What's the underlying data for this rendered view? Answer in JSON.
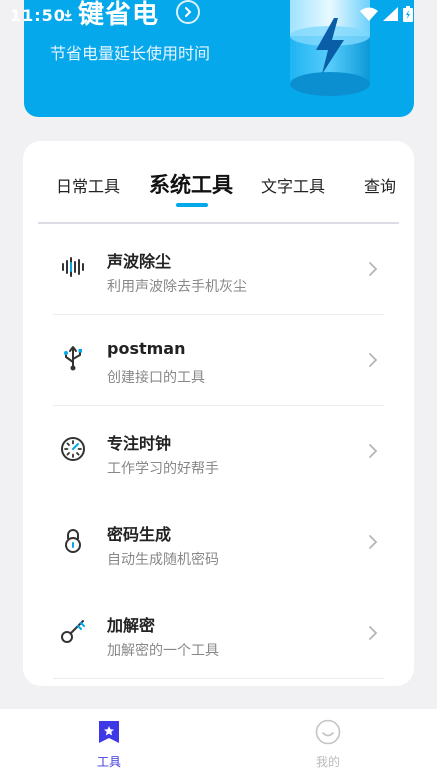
{
  "status_bar": {
    "time": "11:50"
  },
  "hero": {
    "title": "键省电",
    "subtitle": "节省电量延长使用时间"
  },
  "tabs": [
    {
      "label": "日常工具",
      "active": false
    },
    {
      "label": "系统工具",
      "active": true
    },
    {
      "label": "文字工具",
      "active": false
    },
    {
      "label": "查询",
      "active": false
    }
  ],
  "tools": [
    {
      "title": "声波除尘",
      "desc": "利用声波除去手机灰尘",
      "icon": "sound-wave-icon"
    },
    {
      "title": "postman",
      "desc": "创建接口的工具",
      "icon": "usb-icon"
    },
    {
      "title": "专注时钟",
      "desc": "工作学习的好帮手",
      "icon": "clock-dial-icon"
    },
    {
      "title": "密码生成",
      "desc": "自动生成随机密码",
      "icon": "padlock-icon"
    },
    {
      "title": "加解密",
      "desc": "加解密的一个工具",
      "icon": "key-icon"
    }
  ],
  "bottom_nav": [
    {
      "label": "工具",
      "active": true
    },
    {
      "label": "我的",
      "active": false
    }
  ],
  "colors": {
    "accent": "#06a8ec",
    "active_nav": "#3f38e6",
    "inactive_nav": "#bbbbbb"
  }
}
